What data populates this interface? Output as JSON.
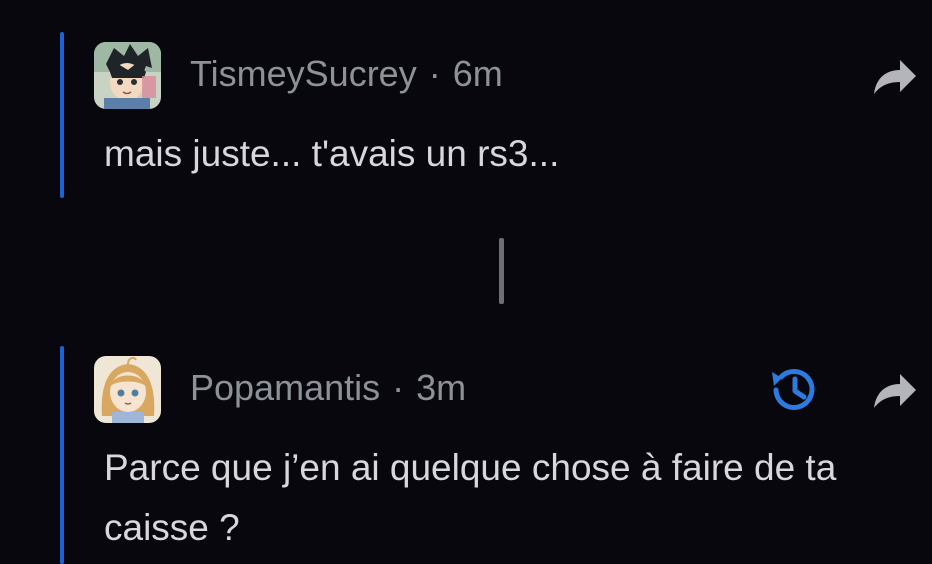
{
  "comments": [
    {
      "username": "TismeySucrey",
      "time": "6m",
      "text": "mais juste... t'avais un rs3...",
      "avatar_icon": "anime-boy-avatar"
    },
    {
      "username": "Popamantis",
      "time": "3m",
      "text": "Parce que j’en ai quelque chose à faire de ta caisse ?",
      "avatar_icon": "anime-girl-avatar",
      "history_icon": "history-icon"
    }
  ],
  "separator_char": "·",
  "colors": {
    "background": "#07070d",
    "thread_bar": "#1d63d8",
    "meta_text": "#8d9299",
    "body_text": "#d7d8dc",
    "icon": "#b3b5ba",
    "history_accent": "#2b7be0"
  }
}
